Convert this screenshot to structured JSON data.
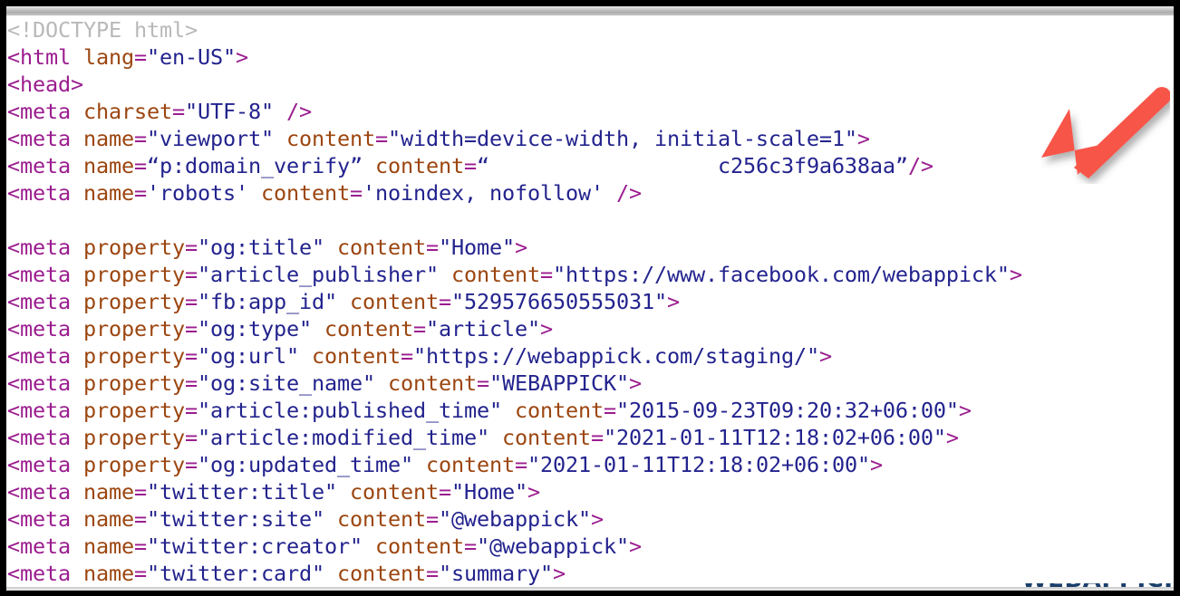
{
  "window": {
    "type": "browser-view-source",
    "border_color": "#000000",
    "background": "#ffffff"
  },
  "syntax_colors": {
    "doctype": "#b9b9b9",
    "tag": "#9b1d8f",
    "punctuation": "#9b1d8f",
    "attribute_name": "#9c4610",
    "attribute_value": "#23238e"
  },
  "annotation": {
    "arrow": {
      "name": "red-arrow-pointer",
      "color": "#f8544a",
      "direction": "down-left",
      "points_at": "c256c3f9a638aa\"/>"
    }
  },
  "bottom_cutoff": {
    "text": "WEBAPPICK",
    "color": "#1b3f6b"
  },
  "source_lines": [
    {
      "id": "line-doctype",
      "segments": [
        {
          "cls": "t-doctype",
          "text": "<!DOCTYPE html>"
        }
      ]
    },
    {
      "id": "line-html-open",
      "segments": [
        {
          "cls": "t-tag",
          "text": "<html "
        },
        {
          "cls": "t-attr",
          "text": "lang"
        },
        {
          "cls": "t-punct",
          "text": "="
        },
        {
          "cls": "t-val",
          "text": "\"en-US\""
        },
        {
          "cls": "t-punct",
          "text": ">"
        }
      ]
    },
    {
      "id": "line-head-open",
      "segments": [
        {
          "cls": "t-tag",
          "text": "<head"
        },
        {
          "cls": "t-punct",
          "text": ">"
        }
      ]
    },
    {
      "id": "line-meta-charset",
      "segments": [
        {
          "cls": "t-tag",
          "text": "<meta "
        },
        {
          "cls": "t-attr",
          "text": "charset"
        },
        {
          "cls": "t-punct",
          "text": "="
        },
        {
          "cls": "t-val",
          "text": "\"UTF-8\""
        },
        {
          "cls": "t-punct",
          "text": " />"
        }
      ]
    },
    {
      "id": "line-meta-viewport",
      "segments": [
        {
          "cls": "t-tag",
          "text": "<meta "
        },
        {
          "cls": "t-attr",
          "text": "name"
        },
        {
          "cls": "t-punct",
          "text": "="
        },
        {
          "cls": "t-val",
          "text": "\"viewport\""
        },
        {
          "cls": "t-attr",
          "text": " content"
        },
        {
          "cls": "t-punct",
          "text": "="
        },
        {
          "cls": "t-val",
          "text": "\"width=device-width, initial-scale=1\""
        },
        {
          "cls": "t-punct",
          "text": ">"
        }
      ]
    },
    {
      "id": "line-meta-domain-verify",
      "segments": [
        {
          "cls": "t-tag",
          "text": "<meta "
        },
        {
          "cls": "t-attr",
          "text": "name"
        },
        {
          "cls": "t-punct",
          "text": "="
        },
        {
          "cls": "t-val",
          "text": "“p:domain_verify”"
        },
        {
          "cls": "t-attr",
          "text": " content"
        },
        {
          "cls": "t-punct",
          "text": "="
        },
        {
          "cls": "t-val",
          "text": "“                  c256c3f9a638aa”"
        },
        {
          "cls": "t-punct",
          "text": "/>"
        }
      ]
    },
    {
      "id": "line-meta-robots",
      "segments": [
        {
          "cls": "t-tag",
          "text": "<meta "
        },
        {
          "cls": "t-attr",
          "text": "name"
        },
        {
          "cls": "t-punct",
          "text": "="
        },
        {
          "cls": "t-val",
          "text": "'robots'"
        },
        {
          "cls": "t-attr",
          "text": " content"
        },
        {
          "cls": "t-punct",
          "text": "="
        },
        {
          "cls": "t-val",
          "text": "'noindex, nofollow'"
        },
        {
          "cls": "t-punct",
          "text": " />"
        }
      ]
    },
    {
      "id": "line-blank-1",
      "segments": [
        {
          "cls": "t-val",
          "text": " "
        }
      ]
    },
    {
      "id": "line-meta-og-title",
      "segments": [
        {
          "cls": "t-tag",
          "text": "<meta "
        },
        {
          "cls": "t-attr",
          "text": "property"
        },
        {
          "cls": "t-punct",
          "text": "="
        },
        {
          "cls": "t-val",
          "text": "\"og:title\""
        },
        {
          "cls": "t-attr",
          "text": " content"
        },
        {
          "cls": "t-punct",
          "text": "="
        },
        {
          "cls": "t-val",
          "text": "\"Home\""
        },
        {
          "cls": "t-punct",
          "text": ">"
        }
      ]
    },
    {
      "id": "line-meta-article-publisher",
      "segments": [
        {
          "cls": "t-tag",
          "text": "<meta "
        },
        {
          "cls": "t-attr",
          "text": "property"
        },
        {
          "cls": "t-punct",
          "text": "="
        },
        {
          "cls": "t-val",
          "text": "\"article_publisher\""
        },
        {
          "cls": "t-attr",
          "text": " content"
        },
        {
          "cls": "t-punct",
          "text": "="
        },
        {
          "cls": "t-val",
          "text": "\"https://www.facebook.com/webappick\""
        },
        {
          "cls": "t-punct",
          "text": ">"
        }
      ]
    },
    {
      "id": "line-meta-fb-app-id",
      "segments": [
        {
          "cls": "t-tag",
          "text": "<meta "
        },
        {
          "cls": "t-attr",
          "text": "property"
        },
        {
          "cls": "t-punct",
          "text": "="
        },
        {
          "cls": "t-val",
          "text": "\"fb:app_id\""
        },
        {
          "cls": "t-attr",
          "text": " content"
        },
        {
          "cls": "t-punct",
          "text": "="
        },
        {
          "cls": "t-val",
          "text": "\"529576650555031\""
        },
        {
          "cls": "t-punct",
          "text": ">"
        }
      ]
    },
    {
      "id": "line-meta-og-type",
      "segments": [
        {
          "cls": "t-tag",
          "text": "<meta "
        },
        {
          "cls": "t-attr",
          "text": "property"
        },
        {
          "cls": "t-punct",
          "text": "="
        },
        {
          "cls": "t-val",
          "text": "\"og:type\""
        },
        {
          "cls": "t-attr",
          "text": " content"
        },
        {
          "cls": "t-punct",
          "text": "="
        },
        {
          "cls": "t-val",
          "text": "\"article\""
        },
        {
          "cls": "t-punct",
          "text": ">"
        }
      ]
    },
    {
      "id": "line-meta-og-url",
      "segments": [
        {
          "cls": "t-tag",
          "text": "<meta "
        },
        {
          "cls": "t-attr",
          "text": "property"
        },
        {
          "cls": "t-punct",
          "text": "="
        },
        {
          "cls": "t-val",
          "text": "\"og:url\""
        },
        {
          "cls": "t-attr",
          "text": " content"
        },
        {
          "cls": "t-punct",
          "text": "="
        },
        {
          "cls": "t-val",
          "text": "\"https://webappick.com/staging/\""
        },
        {
          "cls": "t-punct",
          "text": ">"
        }
      ]
    },
    {
      "id": "line-meta-og-site-name",
      "segments": [
        {
          "cls": "t-tag",
          "text": "<meta "
        },
        {
          "cls": "t-attr",
          "text": "property"
        },
        {
          "cls": "t-punct",
          "text": "="
        },
        {
          "cls": "t-val",
          "text": "\"og:site_name\""
        },
        {
          "cls": "t-attr",
          "text": " content"
        },
        {
          "cls": "t-punct",
          "text": "="
        },
        {
          "cls": "t-val",
          "text": "\"WEBAPPICK\""
        },
        {
          "cls": "t-punct",
          "text": ">"
        }
      ]
    },
    {
      "id": "line-meta-article-published-time",
      "segments": [
        {
          "cls": "t-tag",
          "text": "<meta "
        },
        {
          "cls": "t-attr",
          "text": "property"
        },
        {
          "cls": "t-punct",
          "text": "="
        },
        {
          "cls": "t-val",
          "text": "\"article:published_time\""
        },
        {
          "cls": "t-attr",
          "text": " content"
        },
        {
          "cls": "t-punct",
          "text": "="
        },
        {
          "cls": "t-val",
          "text": "\"2015-09-23T09:20:32+06:00\""
        },
        {
          "cls": "t-punct",
          "text": ">"
        }
      ]
    },
    {
      "id": "line-meta-article-modified-time",
      "segments": [
        {
          "cls": "t-tag",
          "text": "<meta "
        },
        {
          "cls": "t-attr",
          "text": "property"
        },
        {
          "cls": "t-punct",
          "text": "="
        },
        {
          "cls": "t-val",
          "text": "\"article:modified_time\""
        },
        {
          "cls": "t-attr",
          "text": " content"
        },
        {
          "cls": "t-punct",
          "text": "="
        },
        {
          "cls": "t-val",
          "text": "\"2021-01-11T12:18:02+06:00\""
        },
        {
          "cls": "t-punct",
          "text": ">"
        }
      ]
    },
    {
      "id": "line-meta-og-updated-time",
      "segments": [
        {
          "cls": "t-tag",
          "text": "<meta "
        },
        {
          "cls": "t-attr",
          "text": "property"
        },
        {
          "cls": "t-punct",
          "text": "="
        },
        {
          "cls": "t-val",
          "text": "\"og:updated_time\""
        },
        {
          "cls": "t-attr",
          "text": " content"
        },
        {
          "cls": "t-punct",
          "text": "="
        },
        {
          "cls": "t-val",
          "text": "\"2021-01-11T12:18:02+06:00\""
        },
        {
          "cls": "t-punct",
          "text": ">"
        }
      ]
    },
    {
      "id": "line-meta-twitter-title",
      "segments": [
        {
          "cls": "t-tag",
          "text": "<meta "
        },
        {
          "cls": "t-attr",
          "text": "name"
        },
        {
          "cls": "t-punct",
          "text": "="
        },
        {
          "cls": "t-val",
          "text": "\"twitter:title\""
        },
        {
          "cls": "t-attr",
          "text": " content"
        },
        {
          "cls": "t-punct",
          "text": "="
        },
        {
          "cls": "t-val",
          "text": "\"Home\""
        },
        {
          "cls": "t-punct",
          "text": ">"
        }
      ]
    },
    {
      "id": "line-meta-twitter-site",
      "segments": [
        {
          "cls": "t-tag",
          "text": "<meta "
        },
        {
          "cls": "t-attr",
          "text": "name"
        },
        {
          "cls": "t-punct",
          "text": "="
        },
        {
          "cls": "t-val",
          "text": "\"twitter:site\""
        },
        {
          "cls": "t-attr",
          "text": " content"
        },
        {
          "cls": "t-punct",
          "text": "="
        },
        {
          "cls": "t-val",
          "text": "\"@webappick\""
        },
        {
          "cls": "t-punct",
          "text": ">"
        }
      ]
    },
    {
      "id": "line-meta-twitter-creator",
      "segments": [
        {
          "cls": "t-tag",
          "text": "<meta "
        },
        {
          "cls": "t-attr",
          "text": "name"
        },
        {
          "cls": "t-punct",
          "text": "="
        },
        {
          "cls": "t-val",
          "text": "\"twitter:creator\""
        },
        {
          "cls": "t-attr",
          "text": " content"
        },
        {
          "cls": "t-punct",
          "text": "="
        },
        {
          "cls": "t-val",
          "text": "\"@webappick\""
        },
        {
          "cls": "t-punct",
          "text": ">"
        }
      ]
    },
    {
      "id": "line-meta-twitter-card",
      "segments": [
        {
          "cls": "t-tag",
          "text": "<meta "
        },
        {
          "cls": "t-attr",
          "text": "name"
        },
        {
          "cls": "t-punct",
          "text": "="
        },
        {
          "cls": "t-val",
          "text": "\"twitter:card\""
        },
        {
          "cls": "t-attr",
          "text": " content"
        },
        {
          "cls": "t-punct",
          "text": "="
        },
        {
          "cls": "t-val",
          "text": "\"summary\""
        },
        {
          "cls": "t-punct",
          "text": ">"
        }
      ]
    }
  ]
}
